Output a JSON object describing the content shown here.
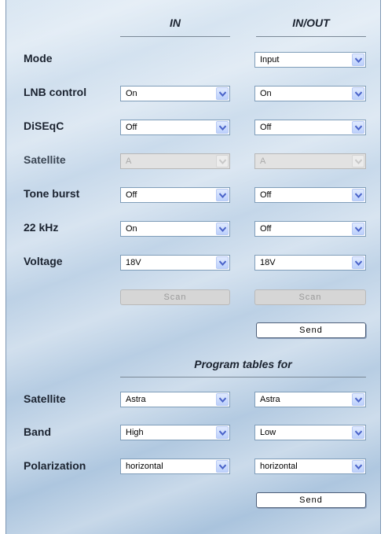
{
  "headers": {
    "in": "IN",
    "inout": "IN/OUT",
    "program_tables": "Program tables for"
  },
  "rows": {
    "mode": {
      "label": "Mode",
      "inout": "Input"
    },
    "lnb": {
      "label": "LNB control",
      "in": "On",
      "inout": "On"
    },
    "diseqc": {
      "label": "DiSEqC",
      "in": "Off",
      "inout": "Off"
    },
    "satellite": {
      "label": "Satellite",
      "in": "A",
      "inout": "A"
    },
    "toneburst": {
      "label": "Tone burst",
      "in": "Off",
      "inout": "Off"
    },
    "khz22": {
      "label": "22 kHz",
      "in": "On",
      "inout": "Off"
    },
    "voltage": {
      "label": "Voltage",
      "in": "18V",
      "inout": "18V"
    }
  },
  "buttons": {
    "scan": "Scan",
    "send": "Send"
  },
  "program": {
    "satellite": {
      "label": "Satellite",
      "in": "Astra",
      "inout": "Astra"
    },
    "band": {
      "label": "Band",
      "in": "High",
      "inout": "Low"
    },
    "polarization": {
      "label": "Polarization",
      "in": "horizontal",
      "inout": "horizontal"
    }
  },
  "colors": {
    "arrow": "#4a63c9",
    "panel_border": "#7f98b4"
  }
}
